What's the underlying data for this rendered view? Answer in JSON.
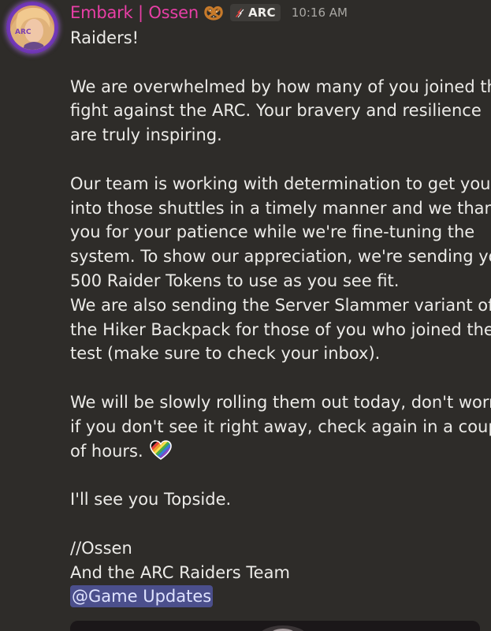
{
  "message": {
    "author": "Embark | Ossen",
    "role_tag": "ARC",
    "timestamp": "10:16 AM",
    "avatar_icon": "user-avatar",
    "role_icon": "lightning-icon",
    "author_emoji": "pretzel-icon",
    "lines": {
      "l1": "Raiders!",
      "l2": "We are overwhelmed by how many of you joined the",
      "l3": "fight against the ARC. Your bravery and resilience",
      "l4": "are truly inspiring.",
      "l5": "Our team is working with determination to get you",
      "l6": "into those shuttles in a timely manner and we thank",
      "l7": "you for your patience while we're fine-tuning the",
      "l8": "system. To show our appreciation, we're sending you",
      "l9": "500 Raider Tokens to use as you see fit.",
      "l10": "We are also sending the Server Slammer variant of",
      "l11": "the Hiker Backpack for those of you who joined the",
      "l12": "test (make sure to check your inbox).",
      "l13": "We will be slowly rolling them out today, don't worry",
      "l14": "if you don't see it right away, check again in a couple",
      "l15": "of hours.",
      "l16": "I'll see you Topside.",
      "l17": "//Ossen",
      "l18": "And the ARC Raiders Team"
    },
    "mention": "@Game Updates",
    "colors": {
      "background": "#2e2c29",
      "author": "#e83fa6",
      "mention_bg": "#4b4f8c",
      "avatar_ring": "#9b5de5"
    }
  }
}
